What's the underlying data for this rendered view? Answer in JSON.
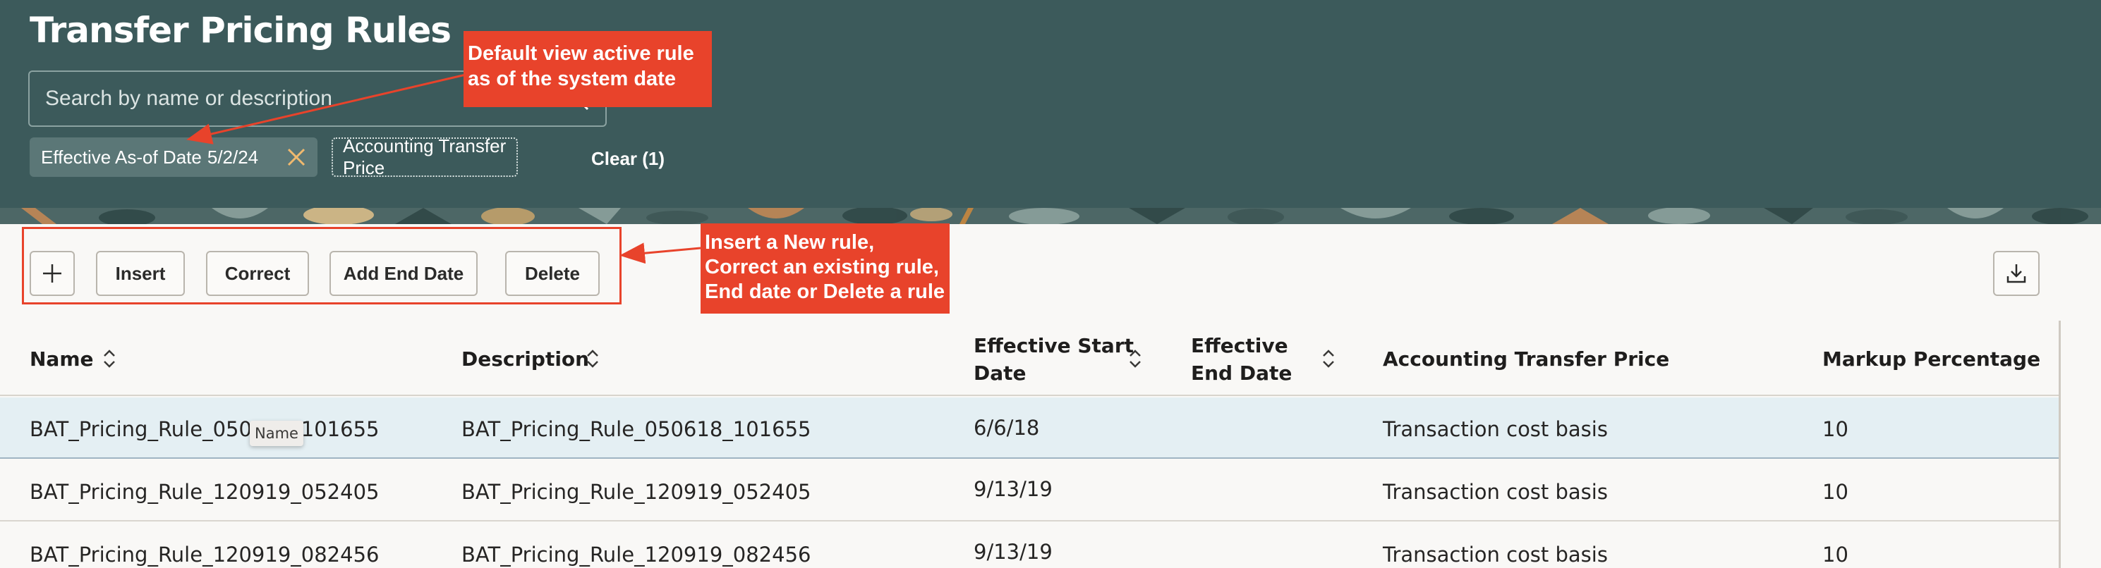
{
  "header": {
    "title": "Transfer Pricing Rules",
    "search_placeholder": "Search by name or description",
    "filters": {
      "date_chip_label": "Effective As-of Date",
      "date_chip_value": "5/2/24",
      "atp_chip_label": "Accounting Transfer Price",
      "clear_label": "Clear (1)"
    }
  },
  "annotations": {
    "callout_default_view": [
      "Default view active rule",
      "as of the system date"
    ],
    "callout_actions": [
      "Insert a New rule,",
      "Correct an existing rule,",
      "End date or Delete a rule"
    ]
  },
  "toolbar": {
    "insert_label": "Insert",
    "correct_label": "Correct",
    "add_end_date_label": "Add End Date",
    "delete_label": "Delete"
  },
  "table": {
    "columns": [
      {
        "label": "Name",
        "sortable": true
      },
      {
        "label": "Description",
        "sortable": true
      },
      {
        "label": [
          "Effective Start",
          "Date"
        ],
        "sortable": true
      },
      {
        "label": [
          "Effective",
          "End Date"
        ],
        "sortable": true
      },
      {
        "label": "Accounting Transfer Price",
        "sortable": false
      },
      {
        "label": "Markup Percentage",
        "sortable": false
      }
    ],
    "rows": [
      {
        "name": "BAT_Pricing_Rule_050618_101655",
        "description": "BAT_Pricing_Rule_050618_101655",
        "start": "6/6/18",
        "end": "",
        "atp": "Transaction cost basis",
        "markup": "10"
      },
      {
        "name": "BAT_Pricing_Rule_120919_052405",
        "description": "BAT_Pricing_Rule_120919_052405",
        "start": "9/13/19",
        "end": "",
        "atp": "Transaction cost basis",
        "markup": "10"
      },
      {
        "name": "BAT_Pricing_Rule_120919_082456",
        "description": "BAT_Pricing_Rule_120919_082456",
        "start": "9/13/19",
        "end": "",
        "atp": "Transaction cost basis",
        "markup": "10"
      }
    ],
    "tooltip": "Name"
  },
  "colors": {
    "header_bg": "#3c5a5b",
    "callout_bg": "#e8432b",
    "selected_row_bg": "#e4eff3",
    "chip_close": "#f0b96e"
  },
  "icons": [
    "search-icon",
    "close-icon",
    "plus-icon",
    "download-icon",
    "sort-icon"
  ]
}
